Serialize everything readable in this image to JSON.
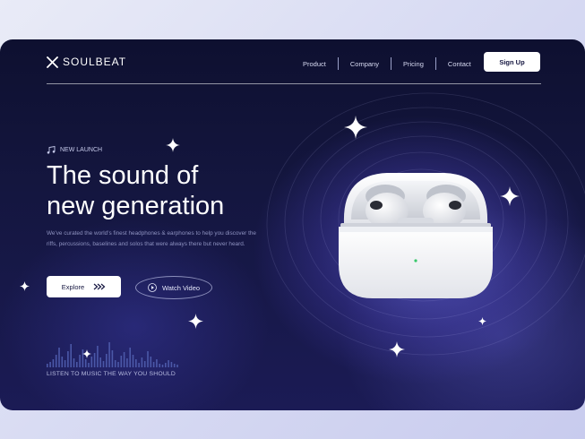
{
  "brand": {
    "name": "SOULBEAT"
  },
  "nav": {
    "items": [
      {
        "label": "Product"
      },
      {
        "label": "Company"
      },
      {
        "label": "Pricing"
      },
      {
        "label": "Contact"
      }
    ],
    "signup_label": "Sign Up"
  },
  "hero": {
    "badge": "NEW LAUNCH",
    "title_line1": "The sound of",
    "title_line2": "new generation",
    "description": "We've curated the world's finest headphones & earphones to help you discover the riffs, percussions, baselines and solos that were always there but never heard.",
    "explore_label": "Explore",
    "watch_label": "Watch Video"
  },
  "footer": {
    "tagline": "LISTEN TO MUSIC THE WAY YOU SHOULD"
  },
  "colors": {
    "background": "#14163f",
    "accent": "#3850c8",
    "button": "#ffffff",
    "text_muted": "#8e92c0"
  },
  "icons": {
    "logo": "x-logo-icon",
    "badge": "music-note-icon",
    "explore": "double-chevron-right-icon",
    "watch": "play-icon",
    "decor": "sparkle-icon"
  },
  "product": {
    "image": "wireless-earbuds-case"
  }
}
